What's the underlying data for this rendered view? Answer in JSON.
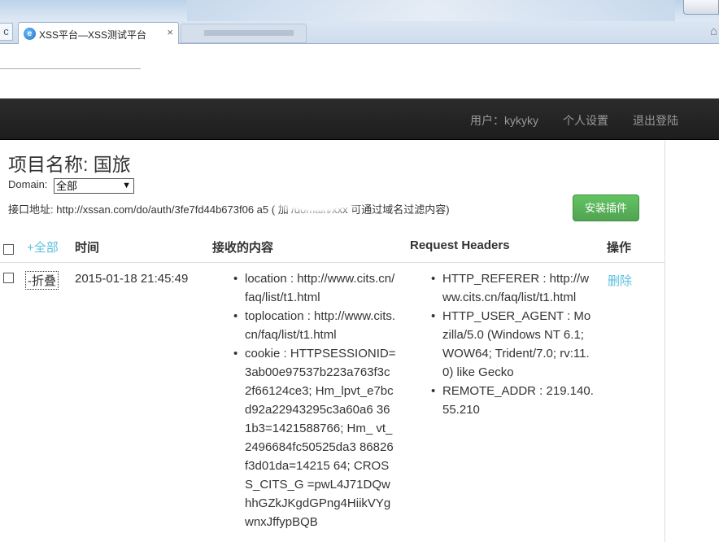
{
  "browser": {
    "tab_title": "XSS平台—XSS测试平台",
    "tab_close": "×",
    "tab_icon": "e",
    "back_glyph": "c",
    "home_glyph": "⌂"
  },
  "navbar": {
    "user": "用户：kykyky",
    "settings": "个人设置",
    "logout": "退出登陆"
  },
  "page": {
    "project_title": "项目名称: 国旅",
    "domain_label": "Domain:",
    "domain_value": "全部",
    "domain_arrow": "▼",
    "api_address": "接口地址: http://xssan.com/do/auth/3fe7fd44b673f06                           a5 ( 加 /domain/xxx 可通过域名过滤内容)",
    "install_button": "安装插件"
  },
  "table": {
    "headers": {
      "select_all": "+全部",
      "time": "时间",
      "content": "接收的内容",
      "request_headers": "Request Headers",
      "operation": "操作"
    },
    "rows": [
      {
        "fold": "-折叠",
        "time": "2015-01-18 21:45:49",
        "content": [
          "location : http://www.cits.cn/faq/list/t1.html",
          "toplocation : http://www.cits.cn/faq/list/t1.html",
          "cookie : HTTPSESSIONID=3ab00e97537b223a763f3c2f66124ce3; Hm_lpvt_e7bc   d92a22943295c3a60a6   361b3=1421588766; Hm_   vt_2496684fc50525da3   86826f3d01da=14215   64; CROSS_CITS_G   =pwL4J71DQwhhGZkJKgdGPng4HiikVYgwnxJffypBQB"
        ],
        "headers": [
          "HTTP_REFERER : http://www.cits.cn/faq/list/t1.html",
          "HTTP_USER_AGENT : Mozilla/5.0 (Windows NT 6.1; WOW64; Trident/7.0; rv:11.0) like Gecko",
          "REMOTE_ADDR : 219.140.55.210"
        ],
        "delete": "删除"
      }
    ]
  }
}
